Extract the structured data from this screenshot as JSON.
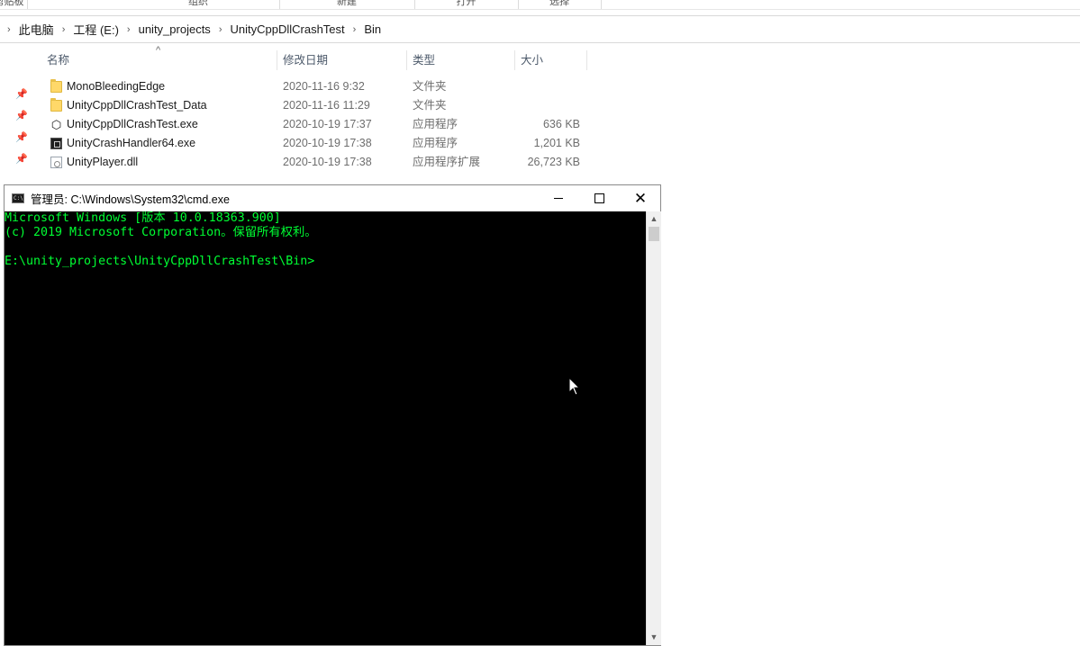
{
  "ribbon": {
    "groups": [
      "剪贴板",
      "组织",
      "新建",
      "打开",
      "选择"
    ]
  },
  "address_bar": {
    "crumbs": [
      "此电脑",
      "工程 (E:)",
      "unity_projects",
      "UnityCppDllCrashTest",
      "Bin"
    ]
  },
  "file_list": {
    "columns": {
      "name": "名称",
      "date": "修改日期",
      "type": "类型",
      "size": "大小"
    },
    "files": [
      {
        "name": "MonoBleedingEdge",
        "date": "2020-11-16 9:32",
        "type": "文件夹",
        "size": "",
        "icon": "folder-icon"
      },
      {
        "name": "UnityCppDllCrashTest_Data",
        "date": "2020-11-16 11:29",
        "type": "文件夹",
        "size": "",
        "icon": "folder-icon"
      },
      {
        "name": "UnityCppDllCrashTest.exe",
        "date": "2020-10-19 17:37",
        "type": "应用程序",
        "size": "636 KB",
        "icon": "unity-icon"
      },
      {
        "name": "UnityCrashHandler64.exe",
        "date": "2020-10-19 17:38",
        "type": "应用程序",
        "size": "1,201 KB",
        "icon": "crash-handler-icon"
      },
      {
        "name": "UnityPlayer.dll",
        "date": "2020-10-19 17:38",
        "type": "应用程序扩展",
        "size": "26,723 KB",
        "icon": "dll-icon"
      }
    ]
  },
  "cmd": {
    "title": "管理员: C:\\Windows\\System32\\cmd.exe",
    "text_color": "#00ff33",
    "lines": [
      "Microsoft Windows [版本 10.0.18363.900]",
      "(c) 2019 Microsoft Corporation。保留所有权利。",
      "",
      "E:\\unity_projects\\UnityCppDllCrashTest\\Bin>"
    ]
  }
}
